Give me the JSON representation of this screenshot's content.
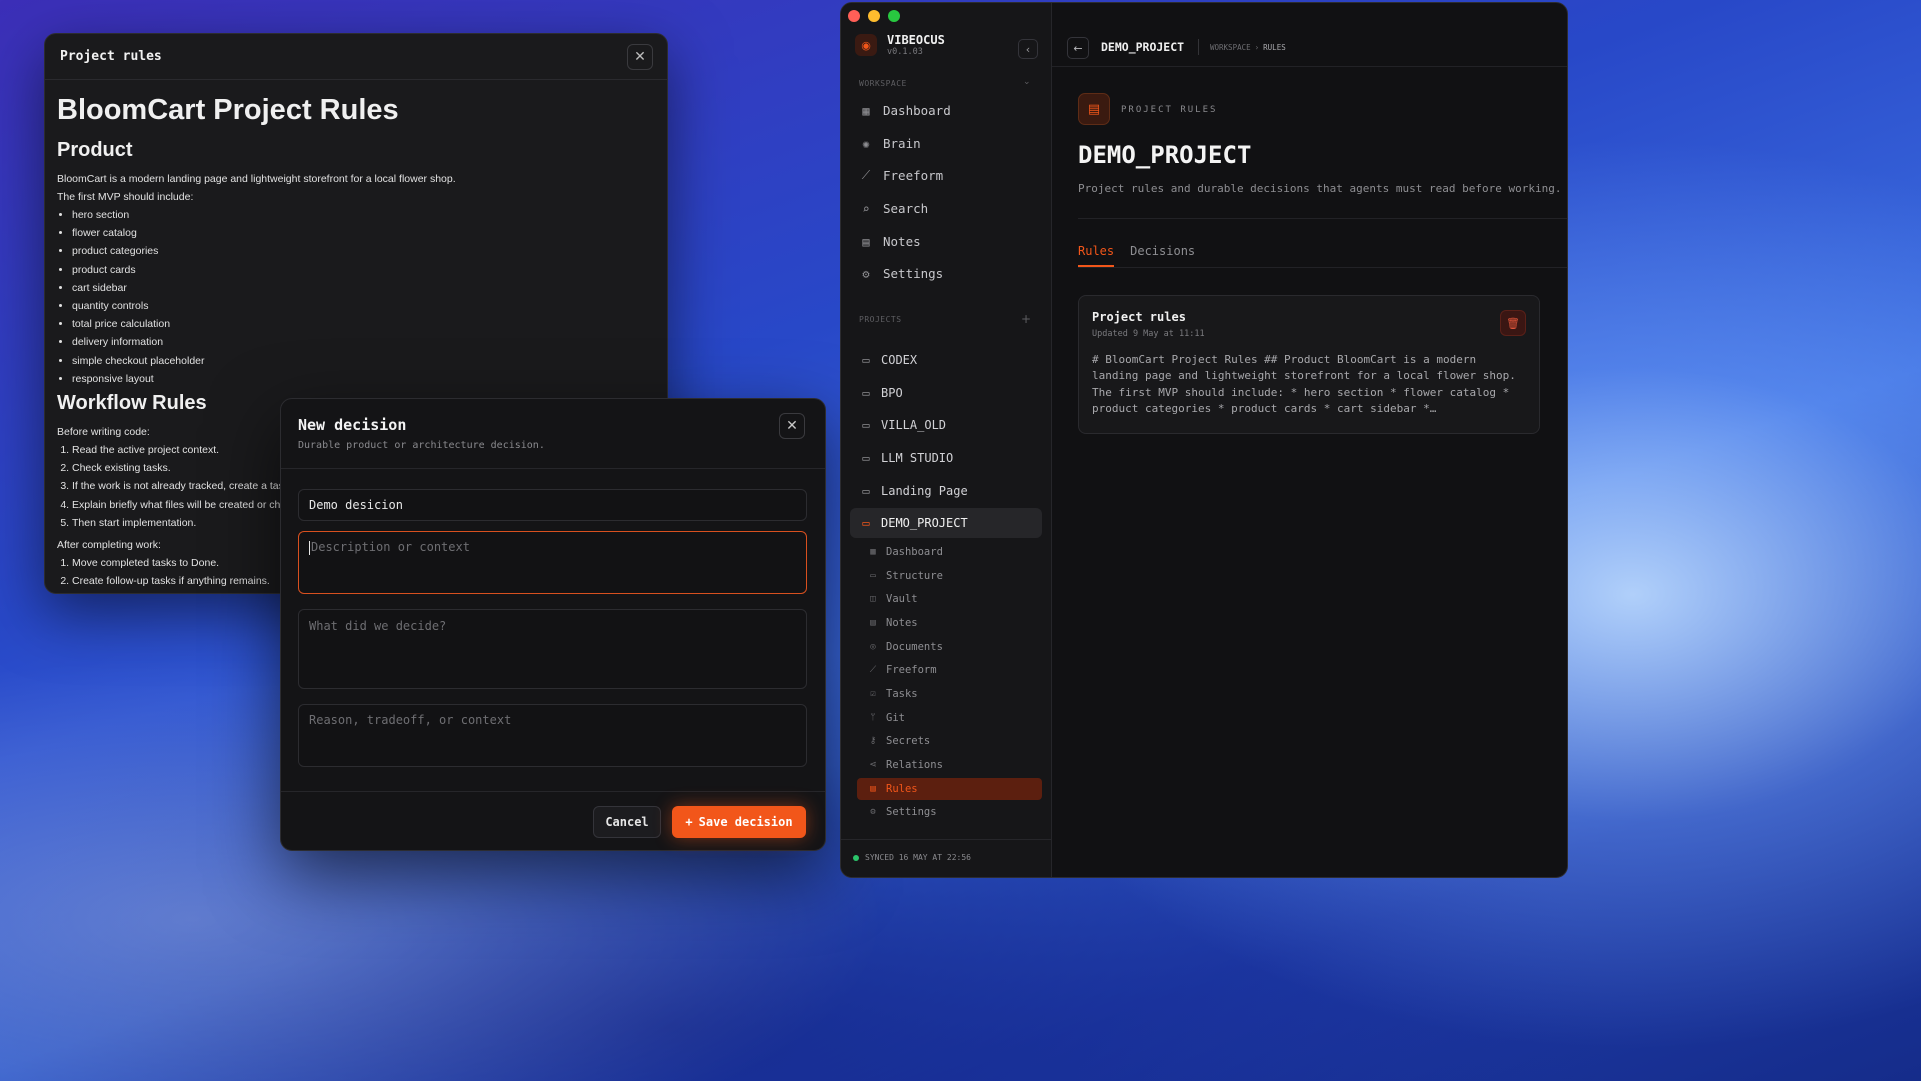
{
  "rules_window": {
    "title": "Project rules",
    "close_icon": "✕",
    "doc": {
      "h1": "BloomCart Project Rules",
      "product_heading": "Product",
      "product_intro": "BloomCart is a modern landing page and lightweight storefront for a local flower shop.",
      "mvp_intro": "The first MVP should include:",
      "mvp_items": [
        "hero section",
        "flower catalog",
        "product categories",
        "product cards",
        "cart sidebar",
        "quantity controls",
        "total price calculation",
        "delivery information",
        "simple checkout placeholder",
        "responsive layout"
      ],
      "workflow_heading": "Workflow Rules",
      "before_intro": "Before writing code:",
      "before_items": [
        "Read the active project context.",
        "Check existing tasks.",
        "If the work is not already tracked, create a tas",
        "Explain briefly what files will be created or chi",
        "Then start implementation."
      ],
      "after_intro": "After completing work:",
      "after_items": [
        "Move completed tasks to Done.",
        "Create follow-up tasks if anything remains."
      ]
    }
  },
  "decision_modal": {
    "title": "New decision",
    "subtitle": "Durable product or architecture decision.",
    "title_value": "Demo desicion",
    "description_placeholder": "Description or context",
    "decision_placeholder": "What did we decide?",
    "reason_placeholder": "Reason, tradeoff, or context",
    "cancel_label": "Cancel",
    "save_label": "Save decision",
    "save_icon": "+"
  },
  "app": {
    "brand_name": "VIBEOCUS",
    "version": "v0.1.03",
    "workspace_label": "WORKSPACE",
    "workspace_nav": [
      {
        "label": "Dashboard",
        "icon": "▦"
      },
      {
        "label": "Brain",
        "icon": "✺"
      },
      {
        "label": "Freeform",
        "icon": "⟋"
      },
      {
        "label": "Search",
        "icon": "⌕"
      },
      {
        "label": "Notes",
        "icon": "▤"
      },
      {
        "label": "Settings",
        "icon": "⚙"
      }
    ],
    "projects_label": "PROJECTS",
    "add_project_icon": "+",
    "projects": [
      "CODEX",
      "BPO",
      "VILLA_OLD",
      "LLM STUDIO",
      "Landing Page",
      "DEMO_PROJECT"
    ],
    "project_sub_nav": [
      "Dashboard",
      "Structure",
      "Vault",
      "Notes",
      "Documents",
      "Freeform",
      "Tasks",
      "Git",
      "Secrets",
      "Relations",
      "Rules",
      "Settings"
    ],
    "sync_status": "SYNCED 16 MAY AT 22:56",
    "topbar": {
      "title": "DEMO_PROJECT",
      "crumb_workspace": "WORKSPACE",
      "crumb_sep": "›",
      "crumb_current": "RULES"
    },
    "page": {
      "kicker": "PROJECT RULES",
      "title": "DEMO_PROJECT",
      "description": "Project rules and durable decisions that agents must read before working.",
      "tabs": [
        "Rules",
        "Decisions"
      ]
    },
    "card": {
      "title": "Project rules",
      "updated": "Updated 9 May at 11:11",
      "body": "# BloomCart Project Rules ## Product BloomCart is a modern landing page and lightweight storefront for a local flower shop. The first MVP should include: * hero section * flower catalog * product categories * product cards * cart sidebar *…"
    },
    "colors": {
      "accent": "#f2561a",
      "close": "#ff5f57",
      "minimize": "#febc2e",
      "maximize": "#28c840"
    }
  }
}
